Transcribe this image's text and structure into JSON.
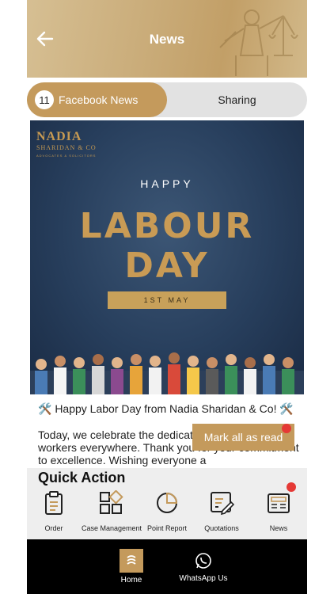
{
  "header": {
    "title": "News"
  },
  "tabs": {
    "active": {
      "count": "11",
      "label": "Facebook News"
    },
    "inactive": {
      "label": "Sharing"
    }
  },
  "post": {
    "image": {
      "brand_name": "NADIA",
      "brand_sub": "SHARIDAN & CO",
      "brand_tag": "ADVOCATES & SOLICITORS",
      "happy": "HAPPY",
      "labour": "LABOUR",
      "day": "DAY",
      "date": "1ST MAY"
    },
    "caption": "🛠️ Happy Labor Day from Nadia Sharidan & Co! 🛠️",
    "body": "Today, we celebrate the dedication of our team and workers everywhere. Thank you for your commitment to excellence. Wishing everyone a"
  },
  "mark_all_read": "Mark all as read",
  "quick_action": {
    "title": "Quick Action",
    "items": [
      {
        "label": "Order",
        "icon": "clipboard-icon"
      },
      {
        "label": "Case Management",
        "icon": "grid-icon"
      },
      {
        "label": "Point Report",
        "icon": "pie-chart-icon"
      },
      {
        "label": "Quotations",
        "icon": "document-edit-icon"
      },
      {
        "label": "News",
        "icon": "newspaper-icon"
      }
    ]
  },
  "bottom_nav": {
    "home": "Home",
    "whatsapp": "WhatsApp Us"
  },
  "colors": {
    "accent": "#c49a5c",
    "badge": "#e53935"
  }
}
